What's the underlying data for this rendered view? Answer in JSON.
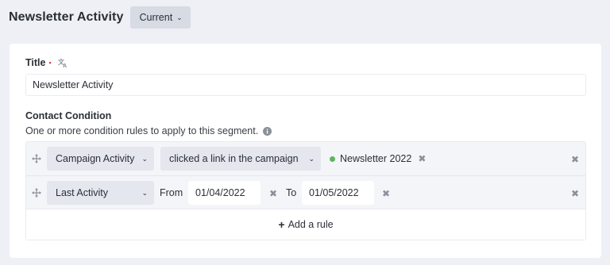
{
  "header": {
    "title": "Newsletter Activity",
    "version_label": "Current"
  },
  "form": {
    "title_label": "Title",
    "required_mark": "•",
    "title_value": "Newsletter Activity",
    "condition_label": "Contact Condition",
    "condition_help": "One or more condition rules to apply to this segment."
  },
  "rules": [
    {
      "field": "Campaign Activity",
      "operator": "clicked a link in the campaign",
      "value_tag": "Newsletter 2022"
    },
    {
      "field": "Last Activity",
      "from_label": "From",
      "from_value": "01/04/2022",
      "to_label": "To",
      "to_value": "01/05/2022"
    }
  ],
  "add_rule_label": "Add a rule",
  "colors": {
    "background": "#eef0f5",
    "required": "#e0375b",
    "tag_dot": "#5cb65f",
    "select_bg": "#e4e7ed"
  },
  "icons": [
    "chevron-down-icon",
    "translate-icon",
    "info-icon",
    "drag-handle-icon",
    "close-icon",
    "plus-icon"
  ]
}
